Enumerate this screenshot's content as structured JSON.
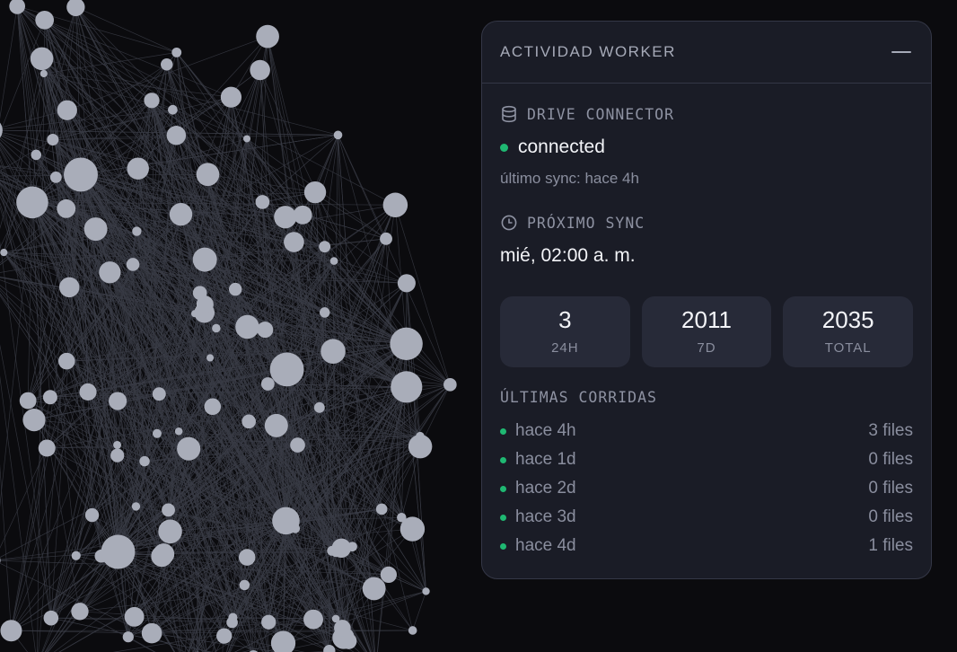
{
  "colors": {
    "background": "#0b0b0e",
    "node": "#a9adb9",
    "edge": "#3a3c46",
    "panel_bg": "#1a1c26",
    "status_ok": "#1fb872"
  },
  "panel": {
    "title": "ACTIVIDAD WORKER",
    "minimize_icon": "minimize-icon",
    "drive": {
      "label": "DRIVE CONNECTOR",
      "icon": "database-icon",
      "status": "connected",
      "last_sync": "último sync: hace 4h"
    },
    "next_sync": {
      "label": "PRÓXIMO SYNC",
      "icon": "clock-icon",
      "value": "mié, 02:00 a. m."
    },
    "stats": [
      {
        "value": "3",
        "label": "24H"
      },
      {
        "value": "2011",
        "label": "7D"
      },
      {
        "value": "2035",
        "label": "TOTAL"
      }
    ],
    "runs_label": "ÚLTIMAS CORRIDAS",
    "runs": [
      {
        "when": "hace 4h",
        "files": "3 files"
      },
      {
        "when": "hace 1d",
        "files": "0 files"
      },
      {
        "when": "hace 2d",
        "files": "0 files"
      },
      {
        "when": "hace 3d",
        "files": "0 files"
      },
      {
        "when": "hace 4d",
        "files": "1 files"
      }
    ]
  }
}
